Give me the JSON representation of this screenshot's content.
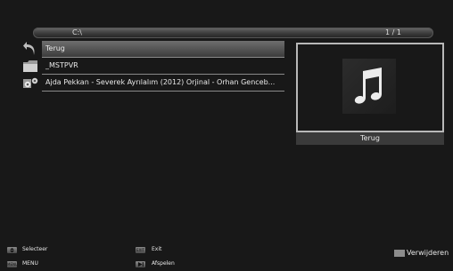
{
  "path_bar": {
    "path": "C:\\",
    "page": "1 / 1"
  },
  "file_list": [
    {
      "label": "Terug",
      "icon": "back-arrow-icon"
    },
    {
      "label": "_MSTPVR",
      "icon": "folder-icon"
    },
    {
      "label": "Ajda Pekkan - Severek Ayrılalım (2012) Orjinal - Orhan Genceb...",
      "icon": "speaker-icon"
    }
  ],
  "preview": {
    "caption": "Terug",
    "icon": "music-note-icon"
  },
  "footer": {
    "select_label": "Selecteer",
    "menu_key": "MENU",
    "menu_label": "MENU",
    "exit_key": "EXIT",
    "exit_label": "Exit",
    "play_label": "Afspelen",
    "delete_label": "Verwijderen"
  },
  "colors": {
    "background": "#181818",
    "selection": "#5a5a5a",
    "text": "#e8e8e8"
  }
}
